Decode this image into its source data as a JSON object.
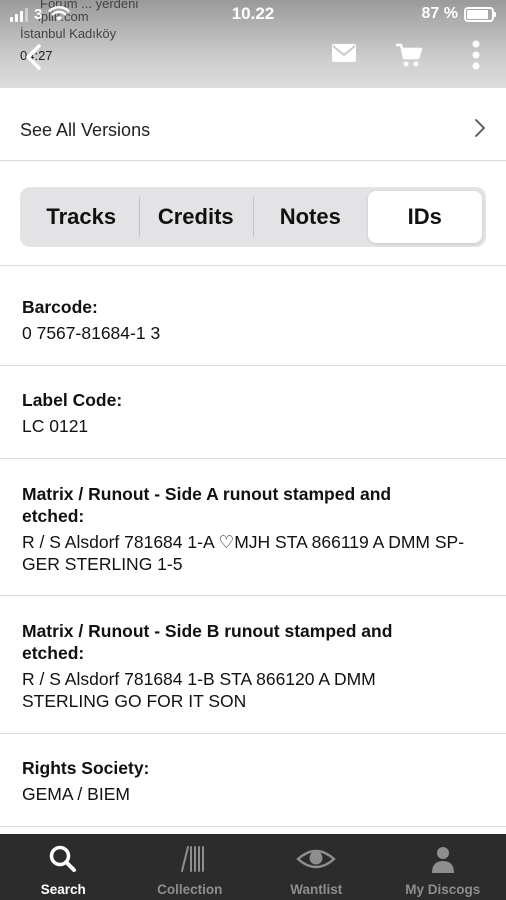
{
  "status_bar": {
    "carrier": "3",
    "time": "10.22",
    "battery": "87 %",
    "battery_level": 0.87
  },
  "overlay_text": {
    "line1": "Forum ... yerdeni",
    "line2": "iplik.com",
    "line3": "İstanbul Kadıköy",
    "line4": "04:27"
  },
  "header": {
    "icons": [
      "back-chevron-icon",
      "mail-icon",
      "cart-icon",
      "more-vertical-icon"
    ]
  },
  "see_all_versions": {
    "label": "See All Versions"
  },
  "segments": {
    "tabs": [
      {
        "label": "Tracks",
        "active": false
      },
      {
        "label": "Credits",
        "active": false
      },
      {
        "label": "Notes",
        "active": false
      },
      {
        "label": "IDs",
        "active": true
      }
    ]
  },
  "ids": [
    {
      "key": "Barcode:",
      "value": "0 7567-81684-1 3"
    },
    {
      "key": "Label Code:",
      "value": "LC 0121"
    },
    {
      "key": "Matrix / Runout - Side A runout stamped and etched:",
      "value": "R / S Alsdorf 781684 1-A ♡MJH STA 866119 A DMM SP-GER STERLING 1-5"
    },
    {
      "key": "Matrix / Runout - Side B runout stamped and etched:",
      "value": "R / S Alsdorf 781684 1-B STA 866120 A DMM STERLING GO FOR IT SON"
    },
    {
      "key": "Rights Society:",
      "value": "GEMA / BIEM"
    }
  ],
  "tabbar": {
    "items": [
      {
        "label": "Search",
        "icon": "search-icon",
        "active": true
      },
      {
        "label": "Collection",
        "icon": "collection-icon",
        "active": false
      },
      {
        "label": "Wantlist",
        "icon": "eye-icon",
        "active": false
      },
      {
        "label": "My Discogs",
        "icon": "person-icon",
        "active": false
      }
    ]
  },
  "colors": {
    "tabbar_bg": "#2c2c2c",
    "segment_bg": "#e3e3e6",
    "separator": "#d9d9d9"
  }
}
